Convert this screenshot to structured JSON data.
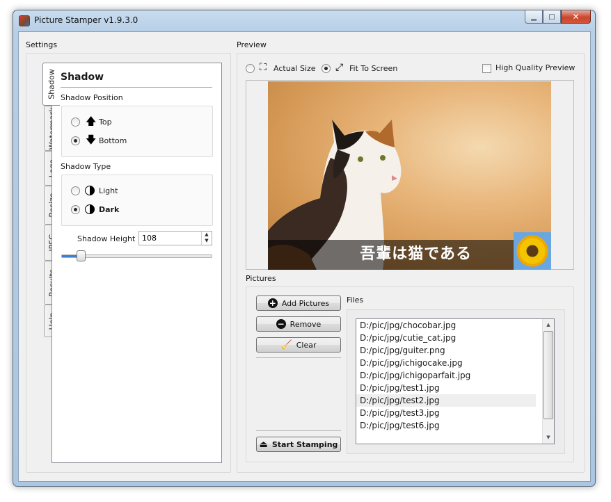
{
  "window": {
    "title": "Picture Stamper v1.9.3.0",
    "minimize_glyph": "▁",
    "maximize_glyph": "□",
    "close_glyph": "✕"
  },
  "settings": {
    "group_label": "Settings",
    "tabs": [
      "Shadow",
      "Watermark",
      "Logo",
      "Resize",
      "JPEG",
      "Results",
      "Help"
    ],
    "active_tab": "Shadow",
    "shadow": {
      "heading": "Shadow",
      "position_label": "Shadow Position",
      "position_options": [
        {
          "label": "Top",
          "icon": "arrow-up-icon",
          "glyph": "🡅",
          "selected": false
        },
        {
          "label": "Bottom",
          "icon": "arrow-down-icon",
          "glyph": "🡇",
          "selected": true
        }
      ],
      "type_label": "Shadow Type",
      "type_options": [
        {
          "label": "Light",
          "icon": "contrast-icon",
          "selected": false
        },
        {
          "label": "Dark",
          "icon": "contrast-icon",
          "selected": true
        }
      ],
      "height_label": "Shadow Height :",
      "height_value": "108",
      "slider_fraction": 0.13
    }
  },
  "preview": {
    "group_label": "Preview",
    "actual_size_label": "Actual Size",
    "fit_to_screen_label": "Fit To Screen",
    "fit_selected": true,
    "high_quality_label": "High Quality Preview",
    "high_quality_checked": false,
    "stamp_text": "吾輩は猫である"
  },
  "pictures": {
    "group_label": "Pictures",
    "add_label": "Add Pictures",
    "remove_label": "Remove",
    "clear_label": "Clear",
    "start_label": "Start Stamping",
    "files_label": "Files",
    "files": [
      "D:/pic/jpg/chocobar.jpg",
      "D:/pic/jpg/cutie_cat.jpg",
      "D:/pic/jpg/guiter.png",
      "D:/pic/jpg/ichigocake.jpg",
      "D:/pic/jpg/ichigoparfait.jpg",
      "D:/pic/jpg/test1.jpg",
      "D:/pic/jpg/test2.jpg",
      "D:/pic/jpg/test3.jpg",
      "D:/pic/jpg/test6.jpg"
    ],
    "selected_file_index": 6
  }
}
